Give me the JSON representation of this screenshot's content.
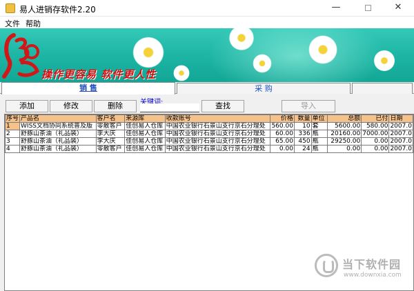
{
  "window": {
    "title": "易人进销存软件2.20",
    "minimize": "—",
    "close": "✕"
  },
  "menu": [
    {
      "label": "文件"
    },
    {
      "label": "帮助"
    }
  ],
  "banner": {
    "slogan": "操作更容易 软件更人性"
  },
  "tabs": [
    {
      "label": "销 售",
      "selected": true
    },
    {
      "label": "采 购",
      "selected": false
    },
    {
      "label": "",
      "selected": false
    }
  ],
  "toolbar": {
    "add": "添加",
    "edit": "修改",
    "delete": "删除",
    "keyword_label": "关键词:",
    "keyword_value": "",
    "search": "查找",
    "import": "导入"
  },
  "table": {
    "columns": [
      "序号",
      "产品名",
      "客户名",
      "来源库",
      "收款账号",
      "价格",
      "数量",
      "单位",
      "总额",
      "已付",
      "日期"
    ],
    "rows": [
      [
        "1",
        "WISS文档协同系统普及版",
        "零散客户",
        "佳创易人仓库",
        "中国农业银行石景山支行京石分理处",
        "560.00",
        "10",
        "套",
        "5600.00",
        "580.00",
        "2007.0"
      ],
      [
        "2",
        "舒豚山茶油（礼品装）",
        "李大庆",
        "佳创易人仓库",
        "中国农业银行石景山支行京石分理处",
        "60.00",
        "336",
        "瓶",
        "20160.00",
        "7000.00",
        "2007.0"
      ],
      [
        "3",
        "舒豚山茶油（礼品装）",
        "李大庆",
        "佳创易人仓库",
        "中国农业银行石景山支行京石分理处",
        "65.00",
        "450",
        "瓶",
        "29250.00",
        "0.00",
        "2007.0"
      ],
      [
        "4",
        "舒豚山茶油（礼品装）",
        "零散客户",
        "佳创易人仓库",
        "中国农业银行石景山支行京石分理处",
        "0.00",
        "24",
        "瓶",
        "0.00",
        "0.00",
        "2007.0"
      ]
    ]
  },
  "watermark": {
    "title": "当下软件园",
    "url": "www.downxia.com"
  }
}
